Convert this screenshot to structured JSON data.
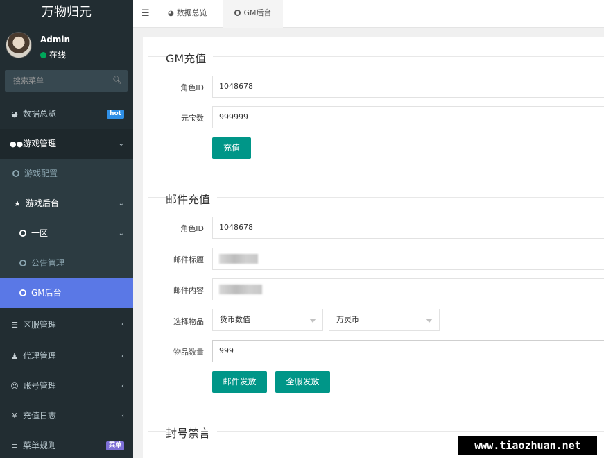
{
  "brand": "万物归元",
  "user": {
    "name": "Admin",
    "status": "在线"
  },
  "search": {
    "placeholder": "搜索菜单"
  },
  "menu": {
    "dashboard": {
      "label": "数据总览",
      "badge": "hot"
    },
    "game_manage": {
      "label": "游戏管理"
    },
    "game_config": {
      "label": "游戏配置"
    },
    "game_backend": {
      "label": "游戏后台"
    },
    "zone1": {
      "label": "一区"
    },
    "announce": {
      "label": "公告管理"
    },
    "gm_backend": {
      "label": "GM后台"
    },
    "server_manage": {
      "label": "区服管理"
    },
    "agent_manage": {
      "label": "代理管理"
    },
    "account_manage": {
      "label": "账号管理"
    },
    "recharge_log": {
      "label": "充值日志"
    },
    "menu_rules": {
      "label": "菜单规则",
      "badge": "菜单"
    }
  },
  "tabs": [
    {
      "label": "数据总览"
    },
    {
      "label": "GM后台"
    }
  ],
  "gm_recharge": {
    "title": "GM充值",
    "role_id_label": "角色ID",
    "role_id_value": "1048678",
    "yuanbao_label": "元宝数",
    "yuanbao_value": "999999",
    "submit_label": "充值"
  },
  "mail_recharge": {
    "title": "邮件充值",
    "role_id_label": "角色ID",
    "role_id_value": "1048678",
    "mail_title_label": "邮件标题",
    "mail_content_label": "邮件内容",
    "item_select_label": "选择物品",
    "item_type_value": "货币数值",
    "item_value": "万灵币",
    "item_qty_label": "物品数量",
    "item_qty_value": "999",
    "send_mail_label": "邮件发放",
    "send_all_label": "全服发放"
  },
  "ban_section": {
    "title": "封号禁言"
  },
  "watermark": "www.tiaozhuan.net",
  "colors": {
    "sidebar": "#222d32",
    "active": "#5a78e6",
    "primary_button": "#009688",
    "online": "#00a65a"
  }
}
